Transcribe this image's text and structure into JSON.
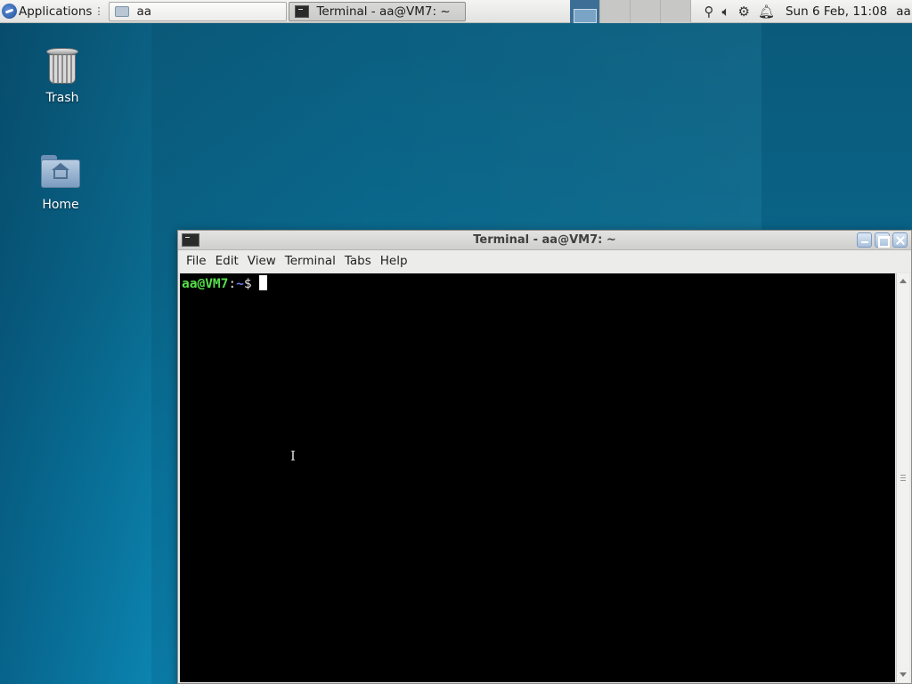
{
  "panel": {
    "applications_label": "Applications",
    "tasks": [
      {
        "label": "aa"
      },
      {
        "label": "Terminal - aa@VM7: ~"
      }
    ],
    "tray_icons": [
      "search-icon",
      "volume-icon",
      "network-icon",
      "notification-bell-icon"
    ],
    "clock": "Sun  6 Feb, 11:08",
    "user": "aa"
  },
  "desktop": {
    "icons": [
      {
        "label": "Trash"
      },
      {
        "label": "Home"
      }
    ]
  },
  "terminal": {
    "title": "Terminal - aa@VM7: ~",
    "menu": [
      "File",
      "Edit",
      "View",
      "Terminal",
      "Tabs",
      "Help"
    ],
    "prompt_user": "aa@VM7",
    "prompt_sep": ":",
    "prompt_path": "~",
    "prompt_symbol": "$",
    "cursor_char": "I"
  },
  "colors": {
    "prompt_user": "#55e04a",
    "prompt_path": "#6b7fe6",
    "terminal_bg": "#000000",
    "desktop_bg": "#0a79a2"
  }
}
